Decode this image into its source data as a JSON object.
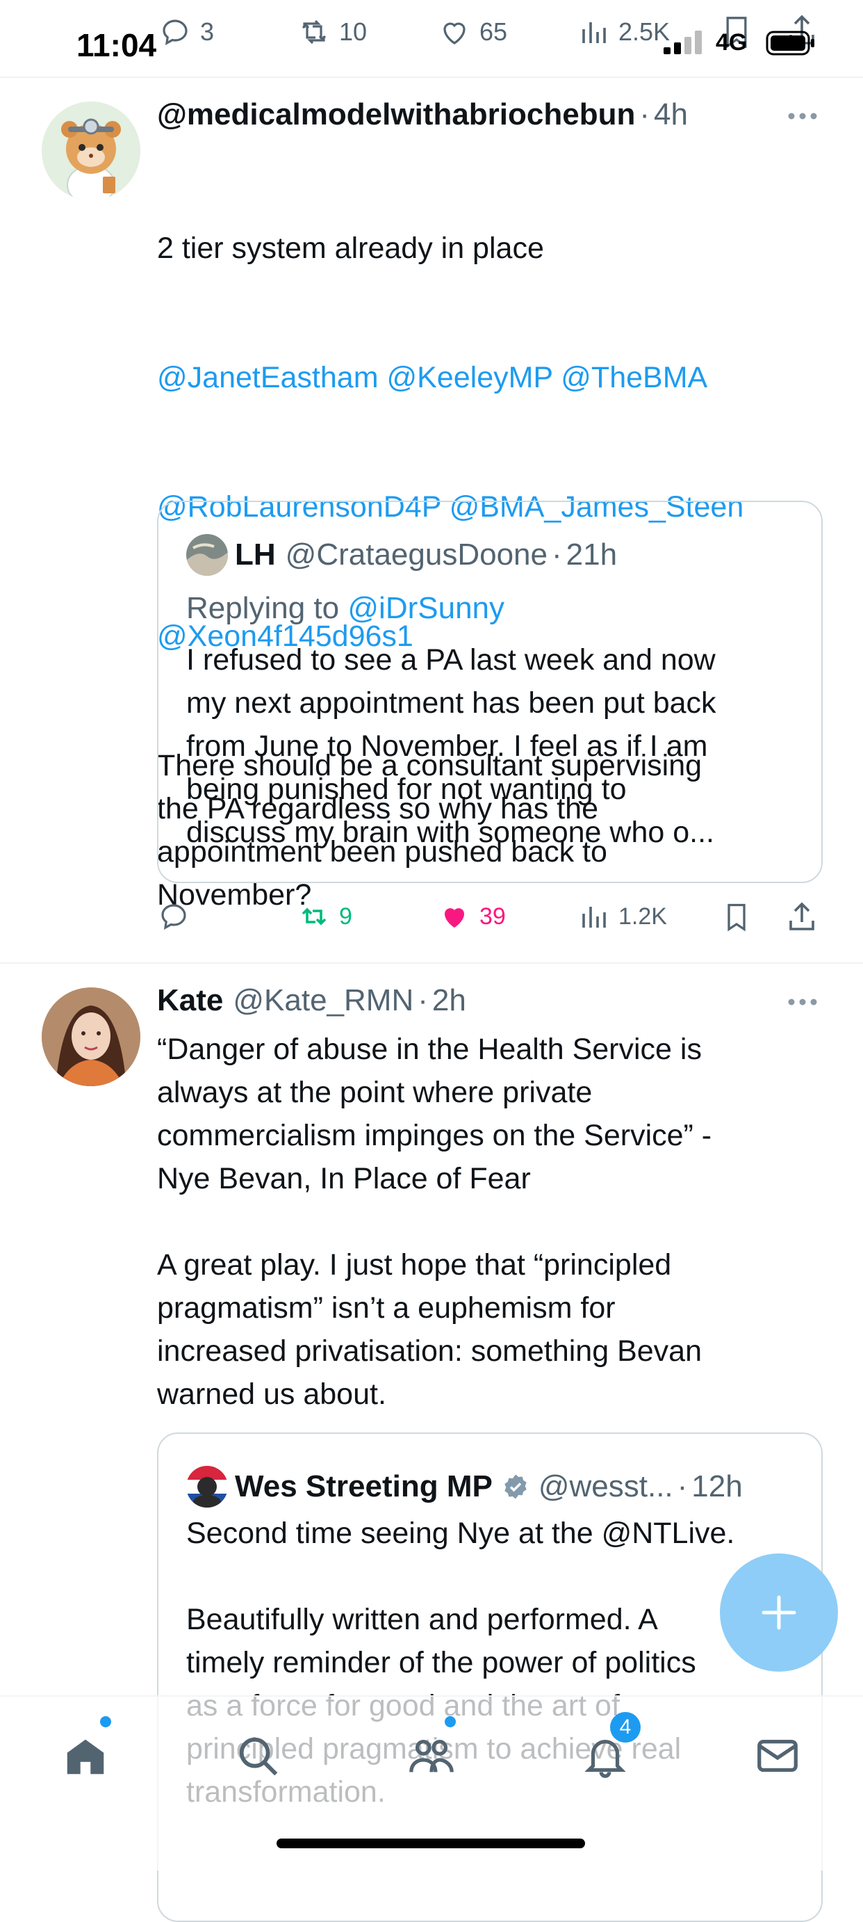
{
  "status_bar": {
    "time": "11:04",
    "network": "4G"
  },
  "top_actions": {
    "replies": "3",
    "retweets": "10",
    "likes": "65",
    "views": "2.5K"
  },
  "tweet1": {
    "name": "@medicalmodelwithabriochebun",
    "time": "4h",
    "line1": "2 tier system already in place",
    "mentions_line1": "@JanetEastham @KeeleyMP @TheBMA",
    "mentions_line2": "@RobLaurensonD4P @BMA_James_Steen",
    "mentions_line3": "@Xeon4f145d96s1",
    "text": "There should be a consultant supervising\nthe PA regardless so why has the\nappointment been pushed back to\nNovember?",
    "quote": {
      "name": "LH",
      "handle": "@CrataegusDoone",
      "time": "21h",
      "replying_prefix": "Replying to",
      "replying_to": "@iDrSunny",
      "text": "I refused to see a PA last week and now\nmy next appointment has been put back\nfrom June to November. I feel as if I am\nbeing punished for not wanting to\ndiscuss my brain with someone who o..."
    },
    "retweets": "9",
    "likes": "39",
    "views": "1.2K"
  },
  "tweet2": {
    "name": "Kate",
    "handle": "@Kate_RMN",
    "time": "2h",
    "text": "“Danger of abuse in the Health Service is\nalways at the point where private\ncommercialism impinges on the Service” -\nNye Bevan, In Place of Fear\n\nA great play. I just hope that “principled\npragmatism” isn’t a euphemism for\nincreased privatisation: something Bevan\nwarned us about.",
    "quote": {
      "name": "Wes Streeting MP",
      "handle": "@wesst...",
      "time": "12h",
      "text": "Second time seeing Nye at the @NTLive.\n\nBeautifully written and performed. A\ntimely reminder of the power of politics\nas a force for good and the art of\nprincipled pragmatism to achieve real\ntransformation."
    }
  },
  "bottom_nav": {
    "notifications_count": "4"
  },
  "colors": {
    "accent": "#1d9bf0",
    "like": "#f91880",
    "retweet": "#00ba7c",
    "text": "#0f1419",
    "muted": "#536471"
  }
}
